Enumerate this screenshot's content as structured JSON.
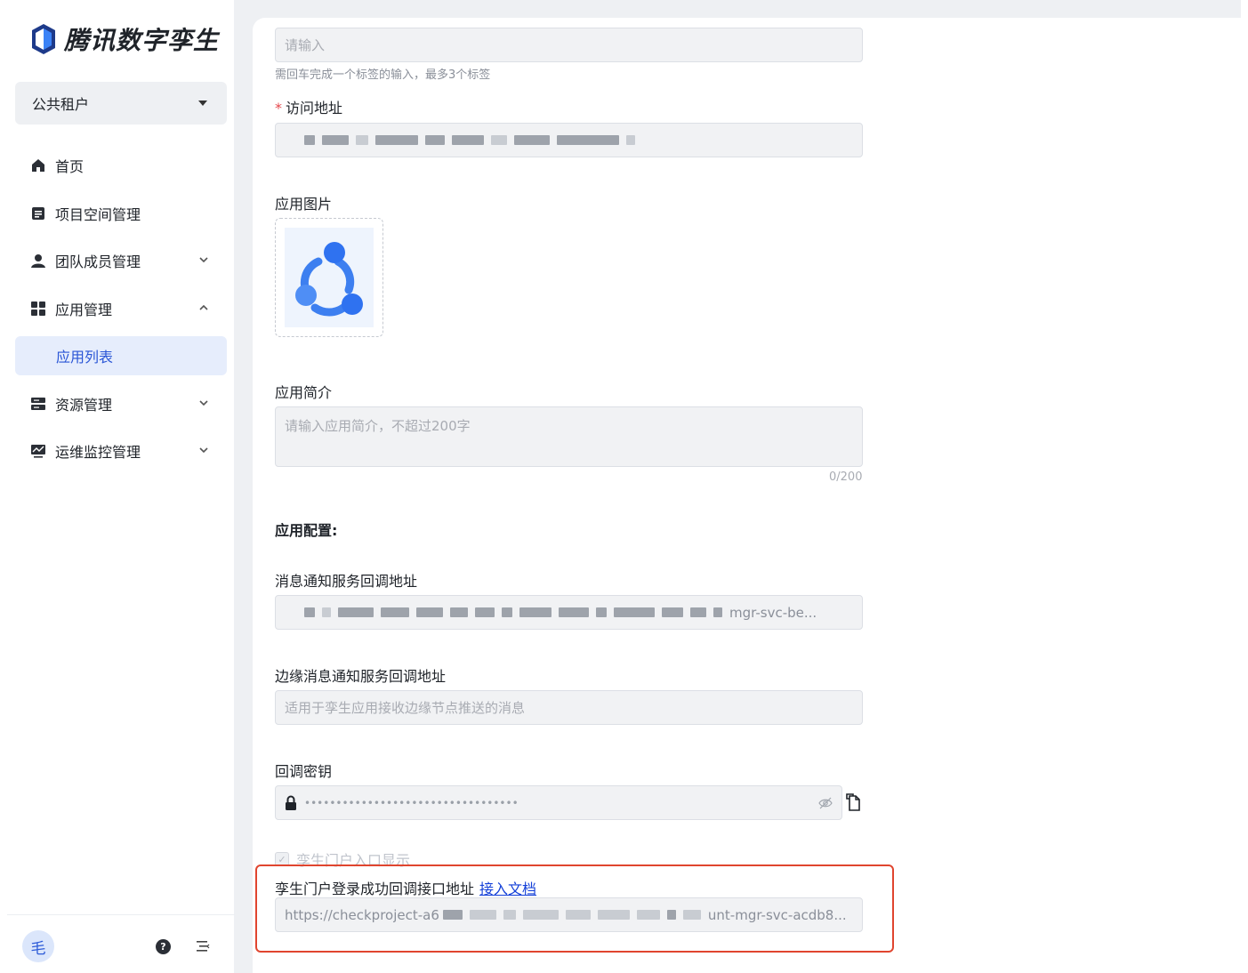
{
  "app": {
    "logo_text": "腾讯数字孪生"
  },
  "sidebar": {
    "tenant": "公共租户",
    "items": [
      {
        "label": "首页",
        "icon": "home-icon"
      },
      {
        "label": "项目空间管理",
        "icon": "document-icon"
      },
      {
        "label": "团队成员管理",
        "icon": "user-icon",
        "expandable": true
      },
      {
        "label": "应用管理",
        "icon": "grid-icon",
        "expanded": true
      },
      {
        "label": "应用列表",
        "active": true
      },
      {
        "label": "资源管理",
        "icon": "server-icon",
        "expandable": true
      },
      {
        "label": "运维监控管理",
        "icon": "monitor-icon",
        "expandable": true
      }
    ],
    "avatar_text": "毛",
    "help_text": "?"
  },
  "form": {
    "tags_placeholder": "请输入",
    "tags_hint": "需回车完成一个标签的输入，最多3个标签",
    "url_label": "访问地址",
    "url_required_mark": "*",
    "image_label": "应用图片",
    "intro_label": "应用简介",
    "intro_placeholder": "请输入应用简介，不超过200字",
    "intro_counter": "0/200",
    "config_title": "应用配置:",
    "callback_label": "消息通知服务回调地址",
    "callback_value_suffix": "mgr-svc-be...",
    "edge_label": "边缘消息通知服务回调地址",
    "edge_placeholder": "适用于孪生应用接收边缘节点推送的消息",
    "secret_label": "回调密钥",
    "secret_value": "••••••••••••••••••••••••••••••••••",
    "portal_checkbox_label": "孪生门户入口显示",
    "login_callback_label": "孪生门户登录成功回调接口地址",
    "doc_link": "接入文档",
    "login_callback_prefix": "https://checkproject-a6",
    "login_callback_suffix": "unt-mgr-svc-acdb8..."
  },
  "colors": {
    "accent": "#2955d6",
    "highlight": "#e0452f",
    "link": "#1440d8"
  }
}
